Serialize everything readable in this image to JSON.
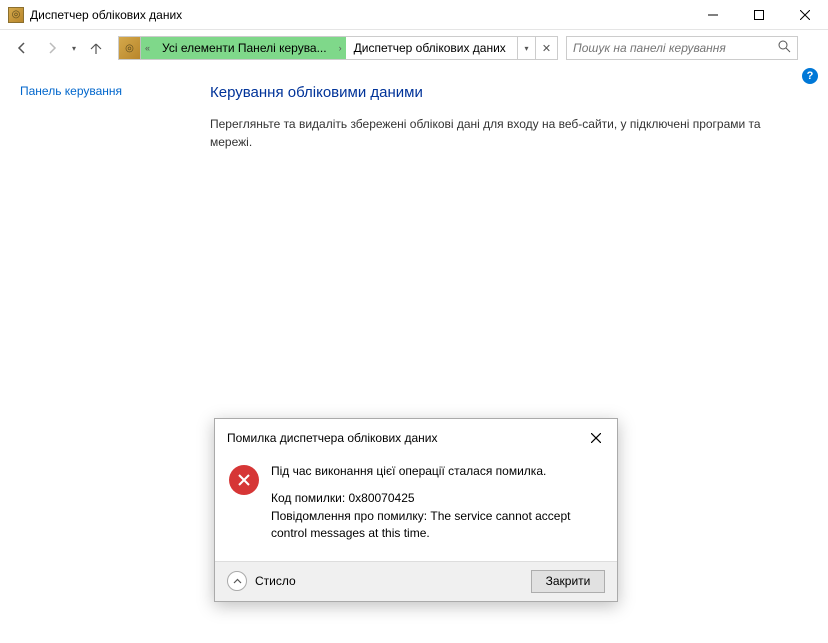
{
  "window": {
    "title": "Диспетчер облікових даних"
  },
  "address": {
    "chevrons": "«",
    "seg1": "Усі елементи Панелі керува...",
    "seg2": "Диспетчер облікових даних"
  },
  "search": {
    "placeholder": "Пошук на панелі керування"
  },
  "sidebar": {
    "home_link": "Панель керування"
  },
  "main": {
    "heading": "Керування обліковими даними",
    "desc": "Перегляньте та видаліть збережені облікові дані для входу на веб-сайти, у підключені програми та мережі."
  },
  "dialog": {
    "title": "Помилка диспетчера облікових даних",
    "message": "Під час виконання цієї операції сталася помилка.",
    "code_label": "Код помилки: 0x80070425",
    "detail": "Повідомлення про помилку: The service cannot accept control messages at this time.",
    "expand_label": "Стисло",
    "close_button": "Закрити"
  }
}
